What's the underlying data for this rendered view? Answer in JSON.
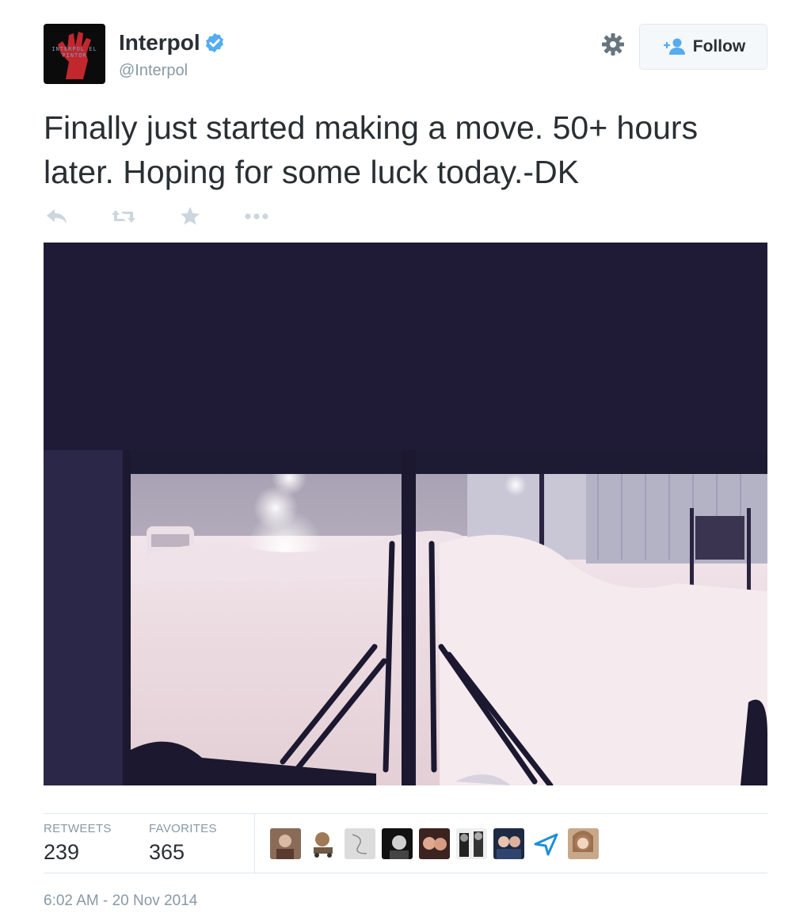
{
  "account": {
    "name": "Interpol",
    "handle": "@Interpol",
    "avatar_text": "INTERPOL EL PINTOR"
  },
  "header": {
    "follow_label": "Follow"
  },
  "tweet": {
    "text": "Finally just started making a move. 50+ hours later. Hoping for some luck today.-DK",
    "timestamp": "6:02 AM - 20 Nov 2014"
  },
  "actions": {
    "items": [
      {
        "icon": "reply-icon"
      },
      {
        "icon": "retweet-icon"
      },
      {
        "icon": "favorite-icon"
      },
      {
        "icon": "more-icon"
      }
    ]
  },
  "stats": {
    "retweets_label": "RETWEETS",
    "retweets_value": "239",
    "favorites_label": "FAVORITES",
    "favorites_value": "365"
  },
  "favoriters_count": 9,
  "colors": {
    "text": "#292f33",
    "muted": "#8899a6",
    "verified": "#55acee",
    "icon": "#ccd6dd",
    "border": "#e1e8ed"
  }
}
